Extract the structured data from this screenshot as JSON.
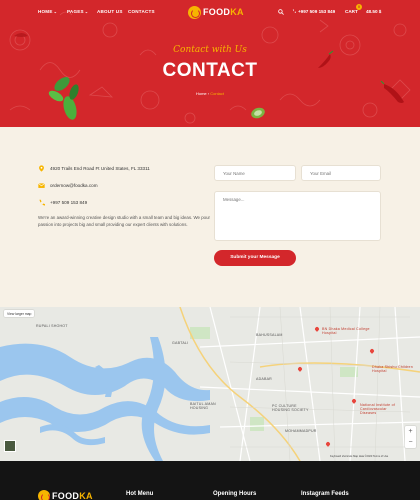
{
  "nav": {
    "items": [
      {
        "label": "HOME",
        "caret": true
      },
      {
        "label": "PAGES",
        "caret": true
      },
      {
        "label": "ABOUT US",
        "caret": false
      },
      {
        "label": "CONTACTS",
        "caret": false
      }
    ],
    "logo_main": "FOOD",
    "logo_accent": "KA",
    "phone": "+997 509 153 849",
    "cart_label": "CART",
    "cart_count": "0",
    "cart_price": "48.50 $"
  },
  "hero": {
    "subtitle": "Contact with Us",
    "title": "CONTACT",
    "breadcrumb_home": "Home",
    "breadcrumb_sep": "›",
    "breadcrumb_current": "Contact"
  },
  "contact": {
    "address": "4920 Trails End Road Ft United States, FL 33311",
    "email": "ordernow@foodka.com",
    "phone": "+997 509 153 849",
    "about": "We're an award-winning creative design studio with a small team and big ideas. We pour passion into projects big and small providing our expert clients with solutions."
  },
  "form": {
    "name_placeholder": "Your Name",
    "email_placeholder": "Your Email",
    "message_placeholder": "Message...",
    "submit_label": "Submit your Message"
  },
  "map": {
    "larger_map": "View larger map",
    "labels": [
      "RUPALI SHOHOT",
      "GABTALI",
      "BAHUSSALAM",
      "ADABAR",
      "BAITUL AMAN HOUSING",
      "PC CULTURE HOUSING SOCIETY",
      "MOHAMMADPUR",
      "Dhaka Shishu Children Hospital",
      "BN Dhaka Medical College Hospital",
      "National Institute of Cardiovascular Diseases"
    ],
    "footer_text": "Keyboard shortcuts   Map data ©2023   Terms of Use"
  },
  "footer": {
    "headings": [
      "Hot Menu",
      "Opening Hours",
      "Instagram Feeds"
    ]
  },
  "colors": {
    "brand_red": "#d3272b",
    "brand_yellow": "#f7b500",
    "page_bg": "#f7f1e6",
    "footer_bg": "#141414"
  },
  "icons": [
    "search-icon",
    "phone-icon",
    "cart-icon",
    "map-pin-icon",
    "mail-icon",
    "phone-icon"
  ]
}
